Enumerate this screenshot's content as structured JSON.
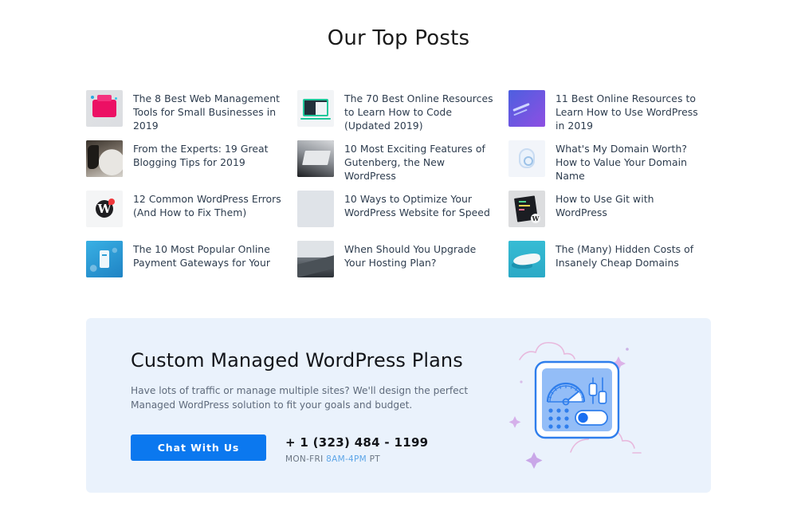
{
  "section": {
    "title": "Our Top Posts"
  },
  "posts": [
    {
      "title": "The 8 Best Web Management Tools for Small Businesses in 2019",
      "thumb": "web-management-tools-thumbnail"
    },
    {
      "title": "The 70 Best Online Resources to Learn How to Code (Updated 2019)",
      "thumb": "learn-to-code-thumbnail"
    },
    {
      "title": "11 Best Online Resources to Learn How to Use WordPress in 2019",
      "thumb": "learn-wordpress-thumbnail"
    },
    {
      "title": "From the Experts: 19 Great Blogging Tips for 2019",
      "thumb": "blogging-tips-thumbnail"
    },
    {
      "title": "10 Most Exciting Features of Gutenberg, the New WordPress",
      "thumb": "gutenberg-thumbnail"
    },
    {
      "title": "What's My Domain Worth? How to Value Your Domain Name",
      "thumb": "domain-worth-thumbnail"
    },
    {
      "title": "12 Common WordPress Errors (And How to Fix Them)",
      "thumb": "wordpress-errors-thumbnail"
    },
    {
      "title": "10 Ways to Optimize Your WordPress Website for Speed",
      "thumb": "optimize-speed-thumbnail"
    },
    {
      "title": "How to Use Git with WordPress",
      "thumb": "git-wordpress-thumbnail"
    },
    {
      "title": "The 10 Most Popular Online Payment Gateways for Your",
      "thumb": "payment-gateways-thumbnail"
    },
    {
      "title": "When Should You Upgrade Your Hosting Plan?",
      "thumb": "upgrade-hosting-thumbnail"
    },
    {
      "title": "The (Many) Hidden Costs of Insanely Cheap Domains",
      "thumb": "cheap-domains-thumbnail"
    }
  ],
  "cta": {
    "title": "Custom Managed WordPress Plans",
    "description": "Have lots of traffic or manage multiple sites? We'll design the perfect Managed WordPress solution to fit your goals and budget.",
    "button_label": "Chat With Us",
    "phone": "+ 1 (323) 484 - 1199",
    "hours_prefix": "MON-FRI ",
    "hours_highlight": "8AM-4PM",
    "hours_suffix": " PT",
    "illustration_name": "control-panel-dashboard-illustration"
  },
  "colors": {
    "accent_blue": "#0b78ef",
    "panel_background": "#eaf2fc",
    "title_text": "#13151a",
    "body_text": "#5f6b7c",
    "post_title_text": "#2d3c4e",
    "hours_highlight": "#5ea6e8"
  }
}
